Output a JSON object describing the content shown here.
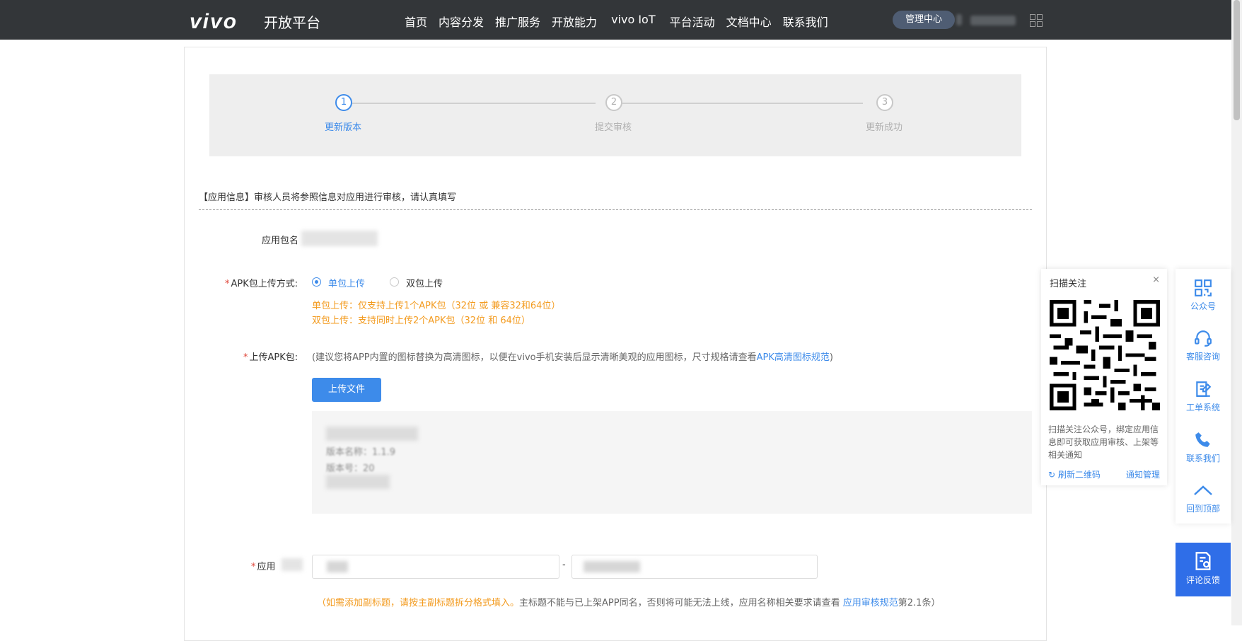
{
  "header": {
    "logo": "vivo",
    "platform": "开放平台",
    "nav": [
      "首页",
      "内容分发",
      "推广服务",
      "开放能力",
      "vivo IoT",
      "平台活动",
      "文档中心",
      "联系我们"
    ],
    "manage_center": "管理中心"
  },
  "steps": [
    {
      "num": "1",
      "label": "更新版本"
    },
    {
      "num": "2",
      "label": "提交审核"
    },
    {
      "num": "3",
      "label": "更新成功"
    }
  ],
  "form": {
    "section_title": "【应用信息】审核人员将参照信息对应用进行审核，请认真填写",
    "package_label": "应用包名",
    "apk_mode_label": "APK包上传方式:",
    "radio_single": "单包上传",
    "radio_double": "双包上传",
    "single_desc": "单包上传：仅支持上传1个APK包（32位 或 兼容32和64位）",
    "double_desc": "双包上传：支持同时上传2个APK包（32位 和 64位）",
    "upload_label": "上传APK包:",
    "upload_hint_pre": "(建议您将APP内置的图标替换为高清图标，以便在vivo手机安装后显示清晰美观的应用图标，尺寸规格请查看",
    "upload_hint_link": "APK高清图标规范",
    "upload_hint_post": ")",
    "upload_button": "上传文件",
    "file_version_name": "版本名称：1.1.9",
    "file_version_code": "版本号：20",
    "app_name_label": "应用",
    "app_name_sep": "-",
    "note_paren_open": "（",
    "note_orange": "如需添加副标题，请按主副标题拆分格式填入。",
    "note_grey": "主标题不能与已上架APP同名，否则将可能无法上线，应用名称相关要求请查看",
    "note_link": "应用审核规范",
    "note_tail": "第2.1条）"
  },
  "follow_panel": {
    "title": "扫描关注",
    "close": "×",
    "desc": "扫描关注公众号，绑定应用信息即可获取应用审核、上架等相关通知",
    "refresh": "刷新二维码",
    "notify": "通知管理"
  },
  "side_rail": [
    {
      "label": "公众号",
      "icon": "qr-icon"
    },
    {
      "label": "客服咨询",
      "icon": "headset-icon"
    },
    {
      "label": "工单系统",
      "icon": "edit-icon"
    },
    {
      "label": "联系我们",
      "icon": "phone-icon"
    },
    {
      "label": "回到顶部",
      "icon": "chevron-up-icon"
    }
  ],
  "feedback": "评论反馈",
  "colors": {
    "accent": "#3d8bea",
    "warning": "#f39b1f",
    "topbar": "#333639",
    "required": "#e0463a"
  }
}
